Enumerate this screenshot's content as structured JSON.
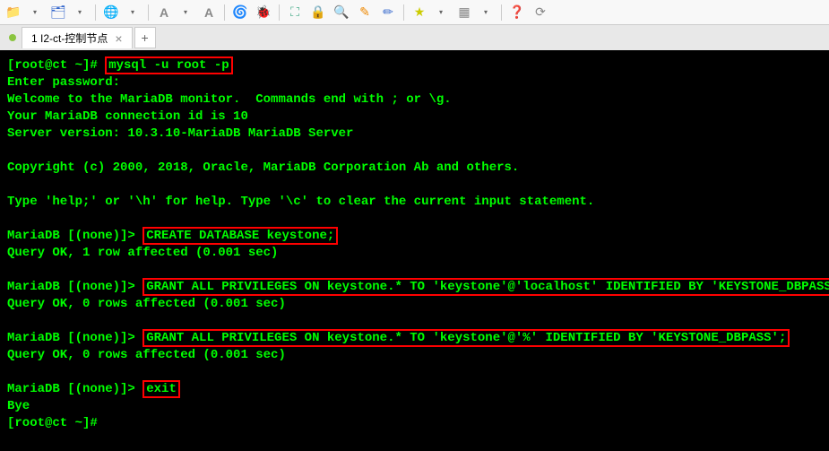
{
  "tabs": {
    "active_label": "1 I2-ct-控制节点"
  },
  "terminal": {
    "prompt1": "[root@ct ~]# ",
    "cmd1": "mysql -u root -p",
    "line_enter_pw": "Enter password:",
    "line_welcome": "Welcome to the MariaDB monitor.  Commands end with ; or \\g.",
    "line_connid": "Your MariaDB connection id is 10",
    "line_version": "Server version: 10.3.10-MariaDB MariaDB Server",
    "line_copyright": "Copyright (c) 2000, 2018, Oracle, MariaDB Corporation Ab and others.",
    "line_help": "Type 'help;' or '\\h' for help. Type '\\c' to clear the current input statement.",
    "mariadb_prompt": "MariaDB [(none)]> ",
    "cmd2": "CREATE DATABASE keystone;",
    "result2": "Query OK, 1 row affected (0.001 sec)",
    "cmd3": "GRANT ALL PRIVILEGES ON keystone.* TO 'keystone'@'localhost' IDENTIFIED BY 'KEYSTONE_DBPASS';",
    "result3": "Query OK, 0 rows affected (0.001 sec)",
    "cmd4": "GRANT ALL PRIVILEGES ON keystone.* TO 'keystone'@'%' IDENTIFIED BY 'KEYSTONE_DBPASS';",
    "result4": "Query OK, 0 rows affected (0.001 sec)",
    "cmd5": "exit",
    "line_bye": "Bye",
    "prompt_end": "[root@ct ~]#"
  }
}
